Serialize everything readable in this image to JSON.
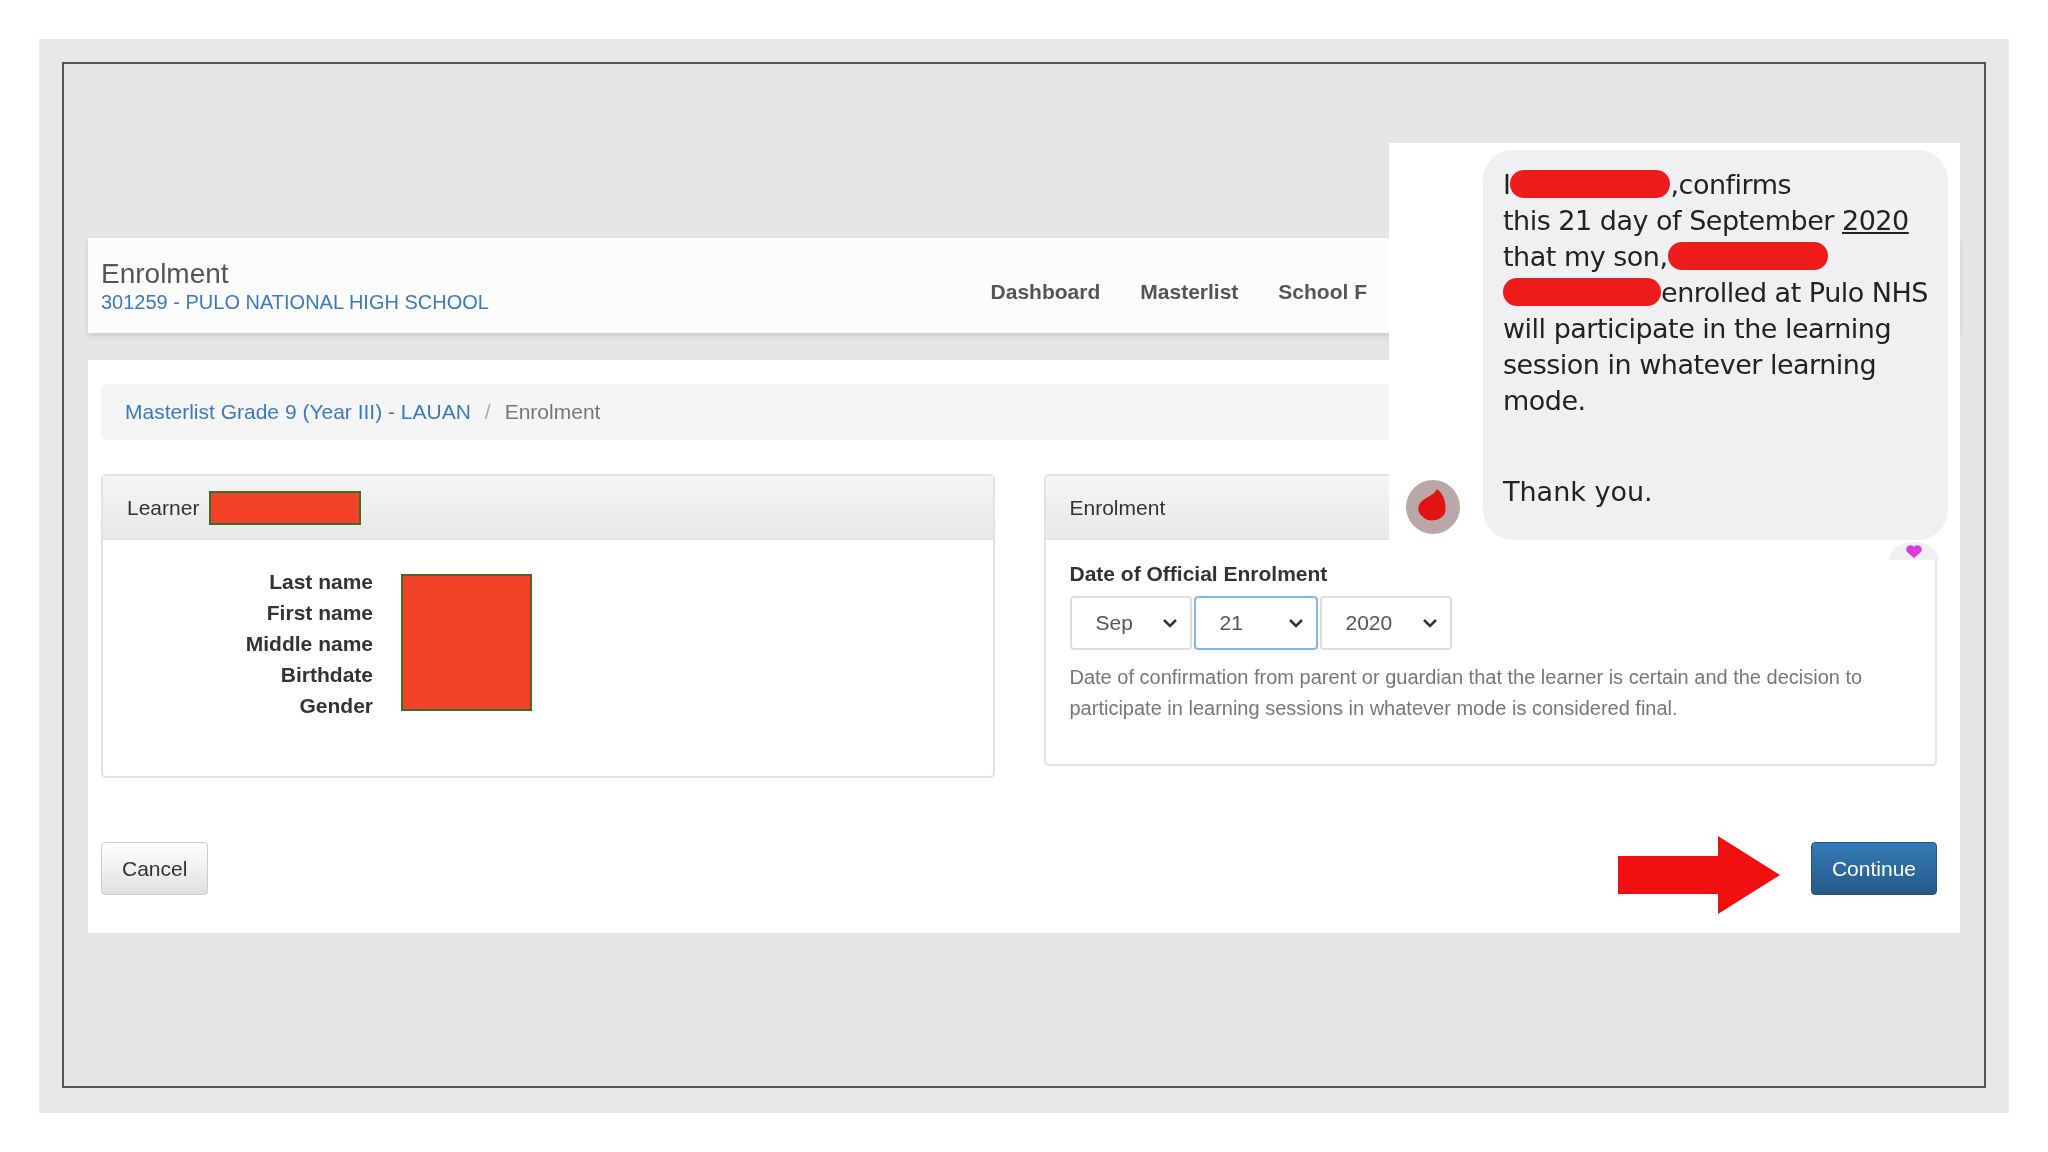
{
  "header": {
    "title": "Enrolment",
    "school": "301259 - PULO NATIONAL HIGH SCHOOL",
    "nav": [
      {
        "label": "Dashboard"
      },
      {
        "label": "Masterlist"
      },
      {
        "label": "School F"
      }
    ]
  },
  "breadcrumb_separator": "/",
  "breadcrumb": [
    {
      "label": "Masterlist Grade 9 (Year III) - LAUAN",
      "link": true
    },
    {
      "label": "Enrolment",
      "link": false
    }
  ],
  "learner_panel": {
    "title": "Learner",
    "title_redacted": true,
    "values_redacted": true,
    "fields": [
      "Last name",
      "First name",
      "Middle name",
      "Birthdate",
      "Gender"
    ]
  },
  "enrolment_panel": {
    "title": "Enrolment",
    "field_label": "Date of Official Enrolment",
    "selects": [
      {
        "value": "Sep",
        "focused": false
      },
      {
        "value": "21",
        "focused": true
      },
      {
        "value": "2020",
        "focused": false
      }
    ],
    "help": "Date of confirmation from parent or guardian that the learner is certain and the decision to participate in learning sessions in whatever mode is considered final."
  },
  "buttons": [
    {
      "label": "Cancel",
      "kind": "default"
    },
    {
      "label": "Continue",
      "kind": "primary"
    }
  ],
  "message": {
    "lines": [
      [
        {
          "kind": "text",
          "text": "I"
        },
        {
          "kind": "redaction"
        },
        {
          "kind": "text",
          "text": ",confirms"
        }
      ],
      [
        {
          "kind": "text",
          "text": "this 21 day of September"
        },
        {
          "kind": "underlined",
          "text": "2020"
        }
      ],
      [
        {
          "kind": "text",
          "text": "that my son,"
        },
        {
          "kind": "redaction"
        }
      ],
      [
        {
          "kind": "redaction"
        },
        {
          "kind": "text",
          "text": "enrolled at Pulo NHS"
        }
      ],
      [
        {
          "kind": "text",
          "text": "will participate in the learning"
        }
      ],
      [
        {
          "kind": "text",
          "text": "session in whatever learning"
        }
      ],
      [
        {
          "kind": "text",
          "text": "mode."
        }
      ]
    ],
    "closing": "Thank you."
  }
}
